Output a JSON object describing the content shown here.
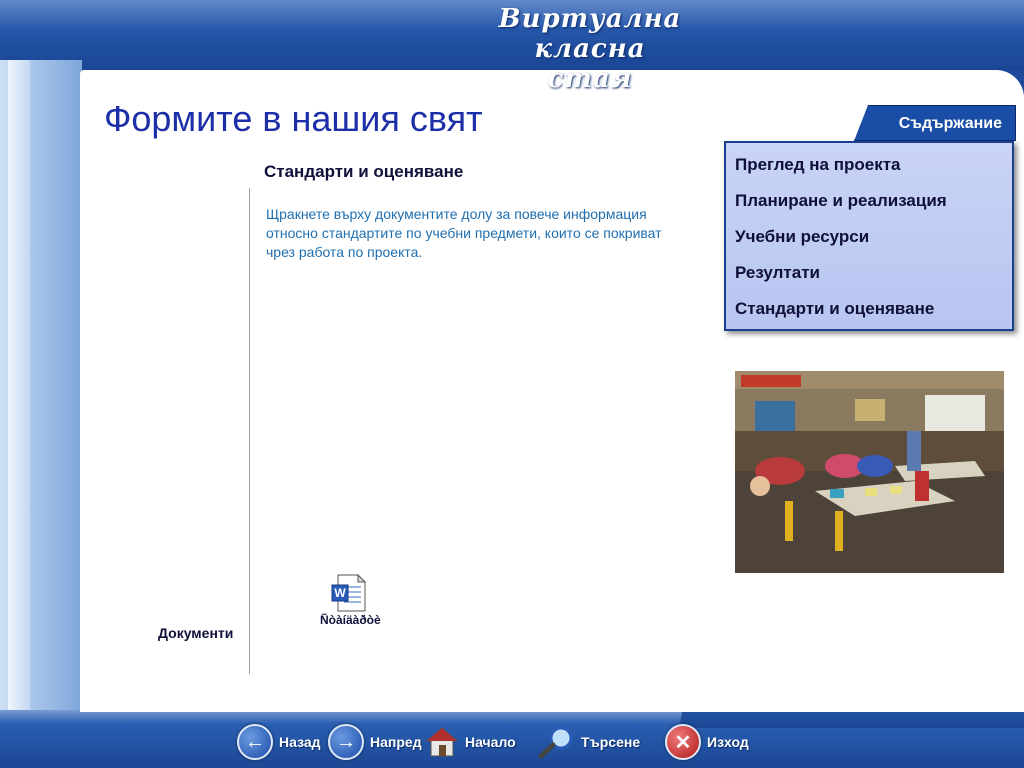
{
  "header": {
    "app_title_line1": "Виртуална класна",
    "app_title_line2": "стая"
  },
  "page": {
    "title": "Формите в нашия свят"
  },
  "section": {
    "heading": "Стандарти и оценяване",
    "intro": "Щракнете върху документите долу за повече информация относно стандартите по учебни предмети, които се покриват чрез работа по проекта."
  },
  "toc": {
    "tab_label": "Съдържание",
    "items": [
      {
        "label": "Преглед на проекта"
      },
      {
        "label": "Планиране и реализация"
      },
      {
        "label": "Учебни ресурси"
      },
      {
        "label": "Резултати"
      },
      {
        "label": "Стандарти и оценяване"
      }
    ]
  },
  "documents": {
    "section_label": "Документи",
    "file_label": "Ñòàíäàðòè",
    "file_icon": "word-document-icon"
  },
  "nav": {
    "back": "Назад",
    "forward": "Напред",
    "home": "Начало",
    "search": "Търсене",
    "exit": "Изход"
  },
  "colors": {
    "accent": "#1a4da6",
    "title": "#1c2fa8",
    "intro_text": "#1f6fb0",
    "toc_bg": "#c9d4f6"
  }
}
